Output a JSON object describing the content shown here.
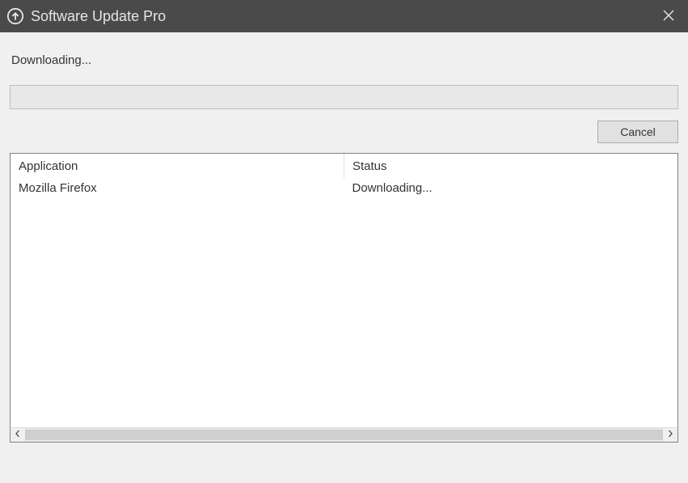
{
  "window": {
    "title": "Software Update Pro"
  },
  "status": {
    "heading": "Downloading..."
  },
  "progress": {
    "percent": 2
  },
  "buttons": {
    "cancel": "Cancel"
  },
  "table": {
    "columns": {
      "application": "Application",
      "status": "Status"
    },
    "rows": [
      {
        "application": "Mozilla Firefox",
        "status": "Downloading..."
      }
    ]
  }
}
